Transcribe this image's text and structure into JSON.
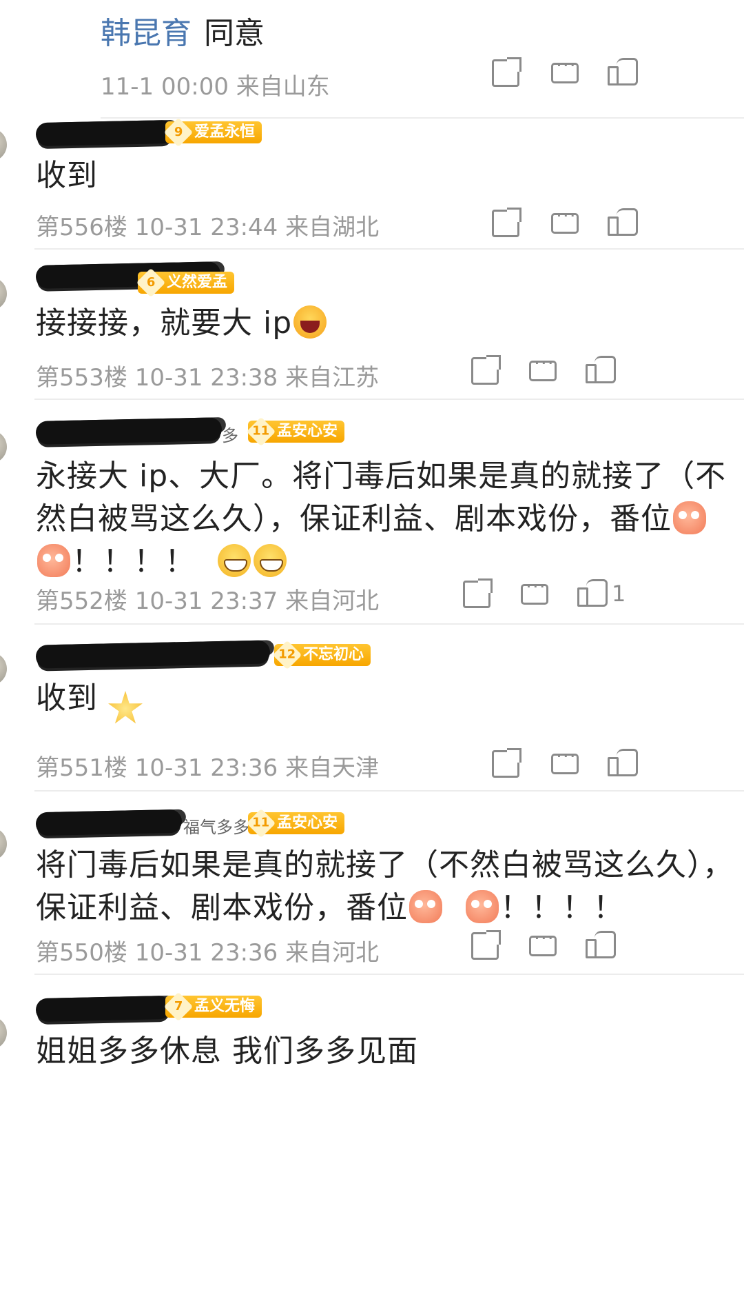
{
  "top_reply": {
    "author": "韩昆育",
    "text": "同意",
    "meta": "11-1 00:00  来自山东"
  },
  "comments": [
    {
      "badge_level": "9",
      "badge_label": "爱孟永恒",
      "content": "收到",
      "meta": "第556楼 10-31 23:44  来自湖北"
    },
    {
      "badge_level": "6",
      "badge_label": "义然爱孟",
      "content": "接接接，就要大 ip",
      "meta": "第553楼 10-31 23:38  来自江苏"
    },
    {
      "user_tail": "多",
      "badge_level": "11",
      "badge_label": "孟安心安",
      "content_lines": [
        "永接大 ip、大厂。将门毒后如果是真的就接了（不",
        "然白被骂这么久），保证利益、剧本戏份，番位",
        "！！！！"
      ],
      "meta": "第552楼 10-31 23:37  来自河北",
      "like_count": "1"
    },
    {
      "badge_level": "12",
      "badge_label": "不忘初心",
      "content": "收到",
      "meta": "第551楼 10-31 23:36  来自天津"
    },
    {
      "user_tail": "福气多多",
      "badge_level": "11",
      "badge_label": "孟安心安",
      "content_lines": [
        "将门毒后如果是真的就接了（不然白被骂这么久），",
        "保证利益、剧本戏份，番位",
        "！！！！"
      ],
      "meta": "第550楼 10-31 23:36  来自河北"
    },
    {
      "badge_level": "7",
      "badge_label": "孟义无悔",
      "content": "姐姐多多休息 我们多多见面"
    }
  ],
  "icons": {
    "share": "share-icon",
    "reply": "comment-icon",
    "like": "thumbs-up-icon",
    "laugh": "laughing-emoji",
    "grin": "grinning-emoji",
    "sweet": "cute-face-emoji"
  },
  "colors": {
    "author_link": "#4a77b0",
    "meta_text": "#9a9a9a",
    "badge": "#f7a600"
  }
}
